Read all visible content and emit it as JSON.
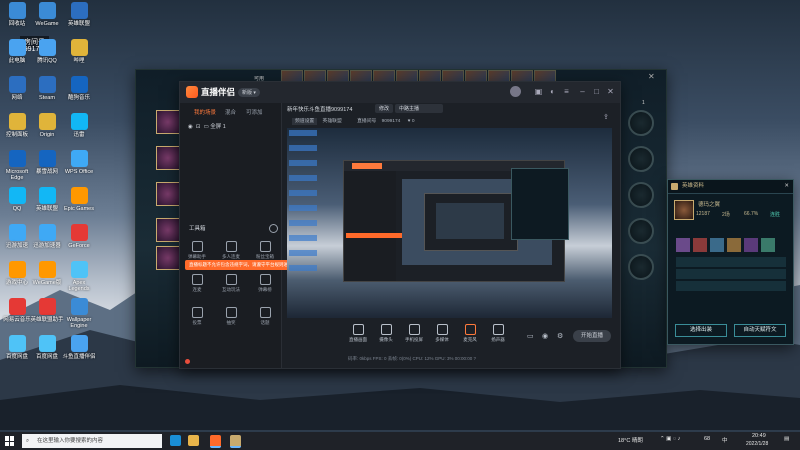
{
  "desktop": {
    "room_label": "房间号",
    "room_number": "9099174",
    "icons_col1": [
      "回收站",
      "此电脑",
      "网络",
      "控制面板",
      "Microsoft Edge",
      "QQ",
      "迅游加速",
      "游戏中心",
      "网易云音乐",
      "百度网盘"
    ],
    "icons_col2": [
      "WeGame",
      "腾讯QQ",
      "Steam",
      "Origin",
      "暴雪战网",
      "英雄联盟",
      "迅游加速器",
      "WeGame版",
      "英雄联盟助手",
      "百度网盘"
    ],
    "icons_col3": [
      "英雄联盟",
      "哔哩",
      "酷狗音乐",
      "迅雷",
      "WPS Office",
      "Epic Games",
      "GeForce",
      "Apex Legends",
      "Wallpaper Engine",
      "斗鱼直播伴侣"
    ]
  },
  "game_window": {
    "top_text": "可用",
    "right_num": "1"
  },
  "zb": {
    "app_name": "直播伴侣",
    "badge": "新版 ▾",
    "tabs": [
      "我的场景",
      "混合",
      "可添加"
    ],
    "scene_row": "全屏 1",
    "tools_title": "工具箱",
    "tools": [
      "弹幕助手",
      "多人连麦",
      "粉丝宝箱",
      "连麦",
      "互动玩法",
      "弹幕榜",
      "投票",
      "抽奖",
      "话题"
    ],
    "warning": "直播标题不允许包含违规字词，请遵守平台规则进行直播设置",
    "live_title": "新年快乐斗鱼直播9099174",
    "edit_btn": "修改",
    "category": "中路主播",
    "channel_label": "频道设置",
    "channel_value": "英雄联盟",
    "room_label": "直播间号",
    "room_value": "9099174",
    "fans": "0",
    "controls": [
      "直播画面",
      "摄像头",
      "手机投屏",
      "多媒体",
      "麦克风",
      "扬声器"
    ],
    "start_btn": "开始直播",
    "status": "码率: 0kbps    FPS: 0    丢帧: 0(0%)    CPU: 12%    GPU: 3%    00:00:00    ?"
  },
  "hero_panel": {
    "title": "英雄资料",
    "hero_name": "德玛之翼",
    "stats": [
      "12187",
      "2场",
      "66.7%",
      "连胜"
    ],
    "btn_left": "选择出装",
    "btn_right": "自动天赋符文"
  },
  "taskbar": {
    "search_placeholder": "在这里输入你要搜索的内容",
    "weather": "18°C 晴朗",
    "ime": "中",
    "clock_time": "20:49",
    "clock_date": "2022/1/28",
    "volume": "68"
  }
}
